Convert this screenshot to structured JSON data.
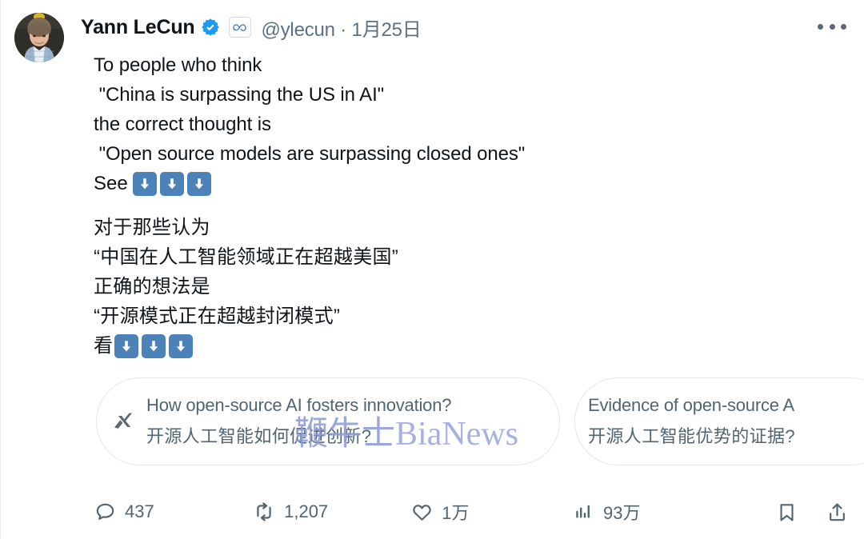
{
  "post": {
    "author": {
      "display_name": "Yann LeCun",
      "handle": "@ylecun",
      "separator": "·",
      "date": "1月25日",
      "verified_badge": "verified-check-icon",
      "affiliate_badge": "meta-infinity-icon",
      "avatar": "yann-lecun-avatar"
    },
    "more_menu": "more-options-icon",
    "text_en": [
      "To people who think",
      " \"China is surpassing the US in AI\"",
      "the correct thought is",
      " \"Open source models are surpassing closed ones\""
    ],
    "see_label": "See",
    "arrow_emoji": "down-arrow-emoji",
    "arrow_count": 3,
    "text_zh": [
      "对于那些认为",
      "“中国在人工智能领域正在超越美国”",
      "正确的想法是",
      "“开源模式正在超越封闭模式”"
    ],
    "see_label_zh": "看"
  },
  "grok_suggestions": {
    "logo": "xai-grok-icon",
    "pills": [
      {
        "en": "How open-source AI fosters innovation?",
        "zh": "开源人工智能如何促进创新?"
      },
      {
        "en": "Evidence of open-source A",
        "zh": "开源人工智能优势的证据?"
      }
    ]
  },
  "watermark": {
    "cn": "鞭牛士",
    "en": "BiaNews"
  },
  "actions": {
    "reply": {
      "icon": "reply-icon",
      "count": "437"
    },
    "retweet": {
      "icon": "retweet-icon",
      "count": "1,207"
    },
    "like": {
      "icon": "heart-icon",
      "count": "1万"
    },
    "views": {
      "icon": "views-chart-icon",
      "count": "93万"
    },
    "bookmark": {
      "icon": "bookmark-icon"
    },
    "share": {
      "icon": "share-icon"
    }
  },
  "colors": {
    "verified_blue": "#1d9bf0",
    "text_primary": "#0f1419",
    "text_secondary": "#536471",
    "emoji_blue": "#4d82b8",
    "watermark": "#9aa7dd"
  }
}
